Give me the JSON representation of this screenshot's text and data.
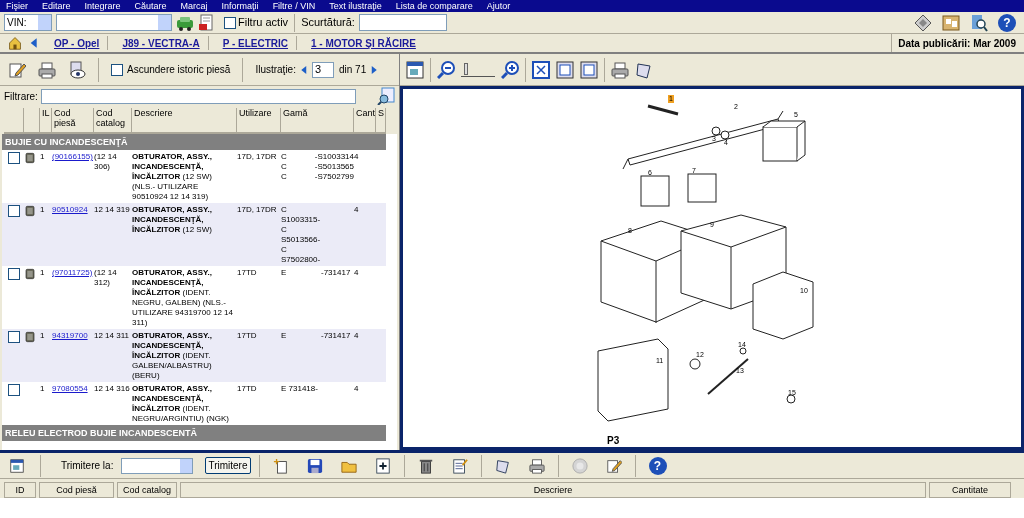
{
  "menu": [
    "Fişier",
    "Editare",
    "Integrare",
    "Căutare",
    "Marcaj",
    "Informaţii",
    "Filtre / VIN",
    "Text ilustraţie",
    "Lista de comparare",
    "Ajutor"
  ],
  "toolbar": {
    "help_glyph": "?",
    "vin_label": "VIN:",
    "filter_active": {
      "label": "Filtru activ",
      "checked": false
    },
    "shortcut_label": "Scurtătură:"
  },
  "breadcrumb": [
    "OP - Opel",
    "J89 - VECTRA-A",
    "P - ELECTRIC",
    "1 - MOTOR ŞI RĂCIRE"
  ],
  "publication_date": "Data publicării: Mar 2009",
  "parts_panel": {
    "hide_history": {
      "label": "Ascundere istoric piesă",
      "checked": false
    },
    "illustration_label": "Ilustraţie:",
    "illustration_value": "3",
    "illustration_total": "din 71",
    "filter_label": "Filtrare:",
    "columns": [
      "IL",
      "Cod piesă",
      "Cod catalog",
      "Descriere",
      "Utilizare",
      "Gamă",
      "Cant",
      "S"
    ],
    "groups": [
      {
        "title": "BUJIE CU INCANDESCENŢĂ",
        "rows": [
          {
            "checked": false,
            "has_icon": true,
            "il": "1",
            "part_code": "(90166155)",
            "catalog_code": "(12 14 306)",
            "description": "**OBTURATOR, ASSY., INCANDESCENŢĂ, ÎNCĂLZITOR** (12 SW) (NLS.- UTILIZARE 90510924 12 14 319)",
            "usage": "17D, 17DR",
            "range_codes": [
              "C",
              "C",
              "C"
            ],
            "range_values": [
              "-S1003314",
              "-S5013565",
              "-S7502799"
            ],
            "qty": "4"
          },
          {
            "checked": false,
            "has_icon": true,
            "il": "1",
            "part_code": "90510924",
            "catalog_code": "12 14 319",
            "description": "**OBTURATOR, ASSY., INCANDESCENŢĂ, ÎNCĂLZITOR** (12 SW)",
            "usage": "17D, 17DR",
            "range_codes": [
              "C",
              "S1003315-",
              "C",
              "S5013566-",
              "C",
              "S7502800-"
            ],
            "range_values": [],
            "qty": "4"
          },
          {
            "checked": false,
            "has_icon": true,
            "il": "1",
            "part_code": "(97011725)",
            "catalog_code": "(12 14 312)",
            "description": "**OBTURATOR, ASSY., INCANDESCENŢĂ, ÎNCĂLZITOR** (IDENT. NEGRU, GALBEN) (NLS.- UTILIZARE 94319700 12 14 311)",
            "usage": "17TD",
            "range_codes": [
              "E"
            ],
            "range_values": [
              "-731417"
            ],
            "qty": "4"
          },
          {
            "checked": false,
            "has_icon": true,
            "il": "1",
            "part_code": "94319700",
            "catalog_code": "12 14 311",
            "description": "**OBTURATOR, ASSY., INCANDESCENŢĂ, ÎNCĂLZITOR** (IDENT. GALBEN/ALBASTRU) (BERU)",
            "usage": "17TD",
            "range_codes": [
              "E"
            ],
            "range_values": [
              "-731417"
            ],
            "qty": "4"
          },
          {
            "checked": false,
            "has_icon": false,
            "il": "1",
            "part_code": "97080554",
            "catalog_code": "12 14 316",
            "description": "**OBTURATOR, ASSY., INCANDESCENŢĂ, ÎNCĂLZITOR** (IDENT. NEGRU/ARGINTIU) (NGK)",
            "usage": "17TD",
            "range_codes": [
              "E 731418-"
            ],
            "range_values": [],
            "qty": "4"
          }
        ]
      },
      {
        "title": "RELEU ELECTROD BUJIE INCANDESCENTĂ"
      }
    ]
  },
  "illustration": {
    "callouts": [
      {
        "label": "1",
        "selected": true
      },
      {
        "label": "2",
        "selected": false
      },
      {
        "label": "3",
        "selected": false
      },
      {
        "label": "4",
        "selected": false
      },
      {
        "label": "5",
        "selected": false
      },
      {
        "label": "6",
        "selected": false
      },
      {
        "label": "7",
        "selected": false
      },
      {
        "label": "8",
        "selected": false
      },
      {
        "label": "9",
        "selected": false
      },
      {
        "label": "10",
        "selected": false
      },
      {
        "label": "11",
        "selected": false
      },
      {
        "label": "12",
        "selected": false
      },
      {
        "label": "14",
        "selected": false
      },
      {
        "label": "13",
        "selected": false
      },
      {
        "label": "15",
        "selected": false
      }
    ],
    "page_label": "P3"
  },
  "zoom_slider": {
    "level": 0.1
  },
  "bottom_toolbar": {
    "help_glyph": "?",
    "send_label": "Trimitere la:",
    "send_button": "Trimitere"
  },
  "bottom_columns": [
    "ID",
    "Cod piesă",
    "Cod catalog",
    "Descriere",
    "Cantitate"
  ]
}
